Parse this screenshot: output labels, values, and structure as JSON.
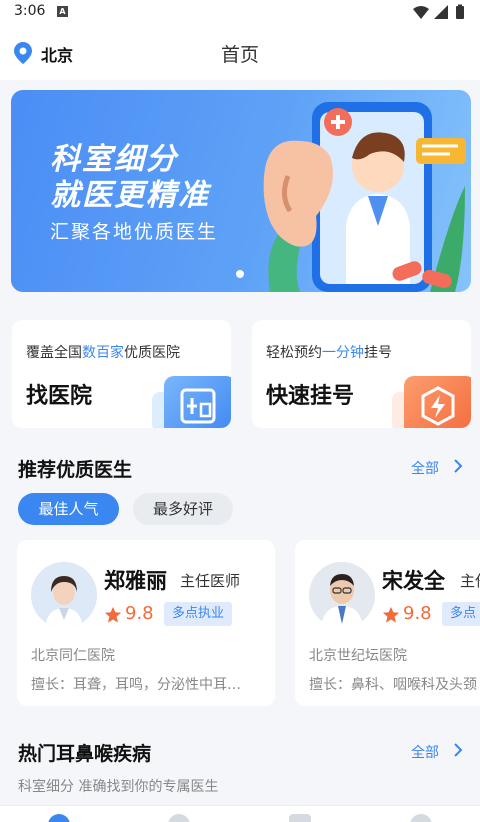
{
  "status_bar": {
    "time": "3:06",
    "notification_icon": "A"
  },
  "header": {
    "location": "北京",
    "title": "首页"
  },
  "banner": {
    "line1": "科室细分",
    "line2": "就医更精准",
    "subtitle": "汇聚各地优质医生",
    "page_indicator_count": 1
  },
  "quick_cards": [
    {
      "subtitle_prefix": "覆盖全国",
      "subtitle_highlight": "数百家",
      "subtitle_suffix": "优质医院",
      "title": "找医院",
      "icon": "hospital-icon",
      "color": "#3e86f3"
    },
    {
      "subtitle_prefix": "轻松预约",
      "subtitle_highlight": "一分钟",
      "subtitle_suffix": "挂号",
      "title": "快速挂号",
      "icon": "lightning-icon",
      "color": "#f56a3c"
    }
  ],
  "recommend": {
    "title": "推荐优质医生",
    "more": "全部",
    "filters": [
      "最佳人气",
      "最多好评"
    ],
    "active_filter": "最佳人气",
    "doctors": [
      {
        "name": "郑雅丽",
        "role": "主任医师",
        "rating": "9.8",
        "tag": "多点执业",
        "hospital": "北京同仁医院",
        "specialty": "擅长：耳聋，耳鸣，分泌性中耳…"
      },
      {
        "name": "宋发全",
        "role": "主任",
        "rating": "9.8",
        "tag": "多点",
        "hospital": "北京世纪坛医院",
        "specialty": "擅长：鼻科、咽喉科及头颈"
      }
    ]
  },
  "hot": {
    "title": "热门耳鼻喉疾病",
    "more": "全部",
    "subtitle": "科室细分 准确找到你的专属医生"
  },
  "colors": {
    "accent": "#3a87f2",
    "rating": "#f26b3a",
    "background": "#f4f6fa"
  }
}
